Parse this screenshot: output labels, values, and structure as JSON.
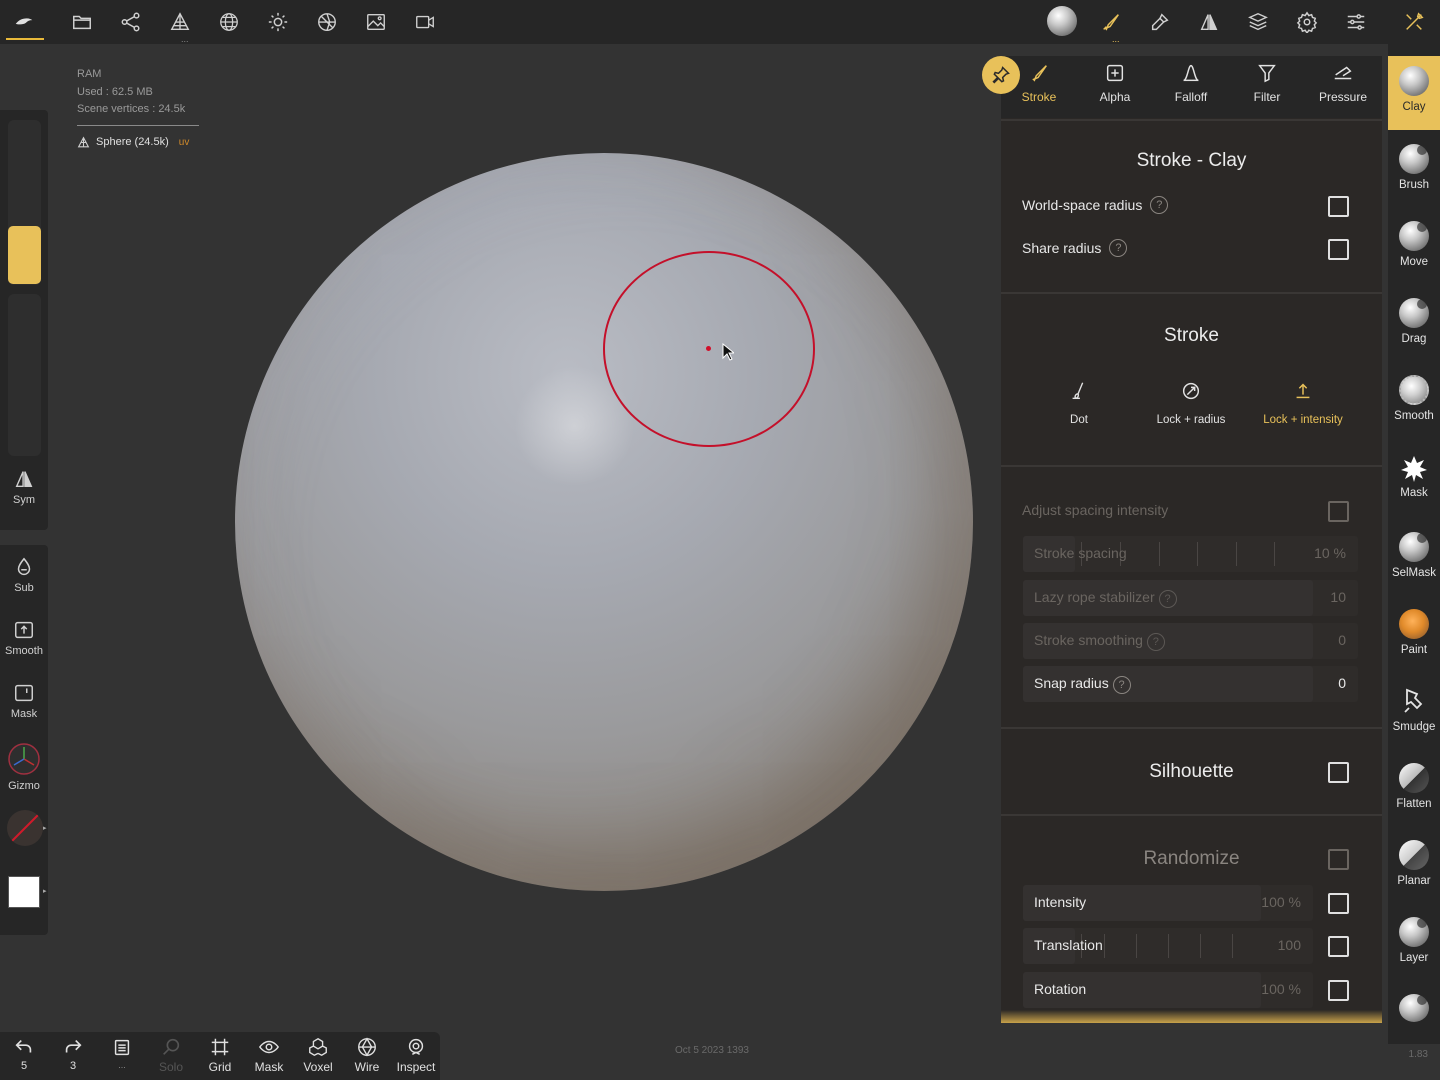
{
  "top_bar": {
    "left_icons": [
      "nomad-logo-icon",
      "folder-icon",
      "share-icon",
      "scene-icon",
      "topology-icon",
      "light-icon",
      "material-icon",
      "background-icon",
      "camera-icon"
    ],
    "right_icons": [
      "material-ball-icon",
      "brush-settings-icon",
      "tools-icon",
      "symmetry-icon",
      "layers-icon",
      "settings-icon",
      "preferences-icon",
      "interface-icon"
    ]
  },
  "scene_info": {
    "ram_label": "RAM",
    "used": "Used : 62.5 MB",
    "vertices": "Scene vertices : 24.5k",
    "mesh_name": "Sphere (24.5k)",
    "uv_badge": "uv"
  },
  "left_toolbar": {
    "radius_fill_fraction": 0.35,
    "sym": "Sym",
    "sub": "Sub",
    "smooth": "Smooth",
    "mask": "Mask",
    "gizmo": "Gizmo",
    "paint_color": "#ffffff"
  },
  "bottom_bar": {
    "undo_count": "5",
    "redo_count": "3",
    "layers_label": "...",
    "solo": "Solo",
    "grid": "Grid",
    "mask": "Mask",
    "voxel": "Voxel",
    "wire": "Wire",
    "inspect": "Inspect"
  },
  "status": {
    "date": "Oct 5 2023 1393",
    "version": "1.83"
  },
  "panel": {
    "tabs": [
      {
        "label": "Stroke",
        "icon": "brush-stroke-icon",
        "active": true
      },
      {
        "label": "Alpha",
        "icon": "alpha-icon",
        "active": false
      },
      {
        "label": "Falloff",
        "icon": "falloff-icon",
        "active": false
      },
      {
        "label": "Filter",
        "icon": "filter-icon",
        "active": false
      },
      {
        "label": "Pressure",
        "icon": "pressure-icon",
        "active": false
      }
    ],
    "stroke_clay": {
      "title": "Stroke - Clay",
      "world_space_radius": "World-space radius",
      "share_radius": "Share radius"
    },
    "stroke": {
      "title": "Stroke",
      "options": [
        {
          "label": "Dot",
          "active": false
        },
        {
          "label": "Lock + radius",
          "active": false
        },
        {
          "label": "Lock + intensity",
          "active": true
        }
      ],
      "adjust_spacing": "Adjust spacing intensity",
      "stroke_spacing": {
        "label": "Stroke spacing",
        "value": "10 %"
      },
      "lazy_rope": {
        "label": "Lazy rope stabilizer",
        "value": "10"
      },
      "stroke_smoothing": {
        "label": "Stroke smoothing",
        "value": "0"
      },
      "snap_radius": {
        "label": "Snap radius",
        "value": "0"
      }
    },
    "silhouette": {
      "title": "Silhouette"
    },
    "randomize": {
      "title": "Randomize",
      "intensity": {
        "label": "Intensity",
        "value": "100 %"
      },
      "translation": {
        "label": "Translation",
        "value": "100"
      },
      "rotation": {
        "label": "Rotation",
        "value": "100 %"
      }
    }
  },
  "tools": [
    {
      "label": "Clay",
      "active": true
    },
    {
      "label": "Brush",
      "active": false
    },
    {
      "label": "Move",
      "active": false
    },
    {
      "label": "Drag",
      "active": false
    },
    {
      "label": "Smooth",
      "active": false
    },
    {
      "label": "Mask",
      "active": false
    },
    {
      "label": "SelMask",
      "active": false
    },
    {
      "label": "Paint",
      "active": false
    },
    {
      "label": "Smudge",
      "active": false
    },
    {
      "label": "Flatten",
      "active": false
    },
    {
      "label": "Planar",
      "active": false
    },
    {
      "label": "Layer",
      "active": false
    }
  ],
  "colors": {
    "accent": "#e8c15a",
    "brush_ring": "#c4102a",
    "background": "#333333"
  }
}
